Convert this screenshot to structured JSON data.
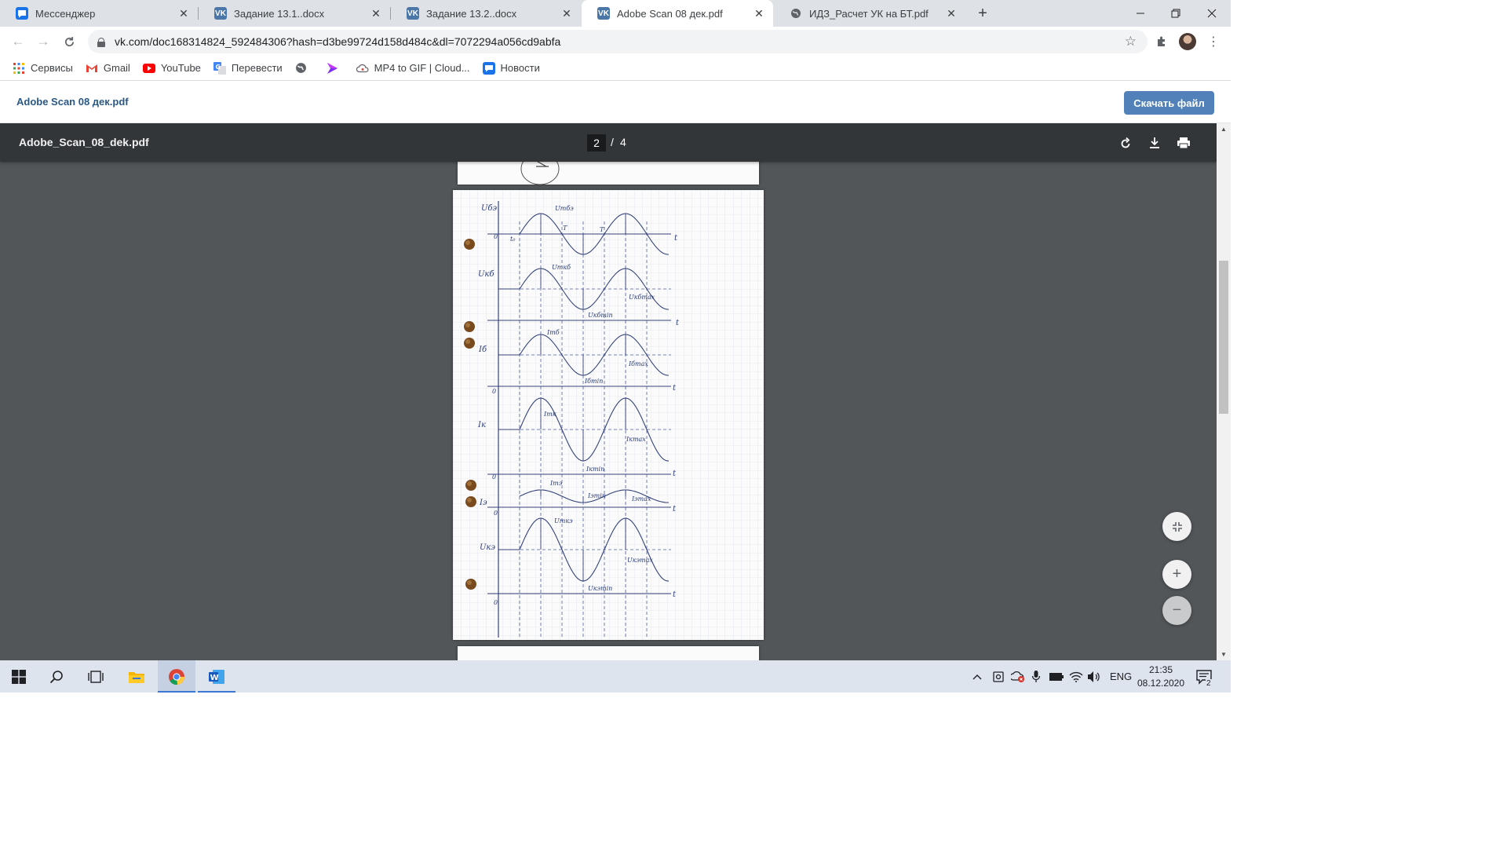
{
  "tabs": [
    {
      "title": "Мессенджер",
      "icon": "messenger-icon",
      "active": false
    },
    {
      "title": "Задание 13.1..docx",
      "icon": "vk-icon",
      "active": false
    },
    {
      "title": "Задание 13.2..docx",
      "icon": "vk-icon",
      "active": false
    },
    {
      "title": "Adobe Scan 08 дек.pdf",
      "icon": "vk-icon",
      "active": true
    },
    {
      "title": "ИДЗ_Расчет УК на БТ.pdf",
      "icon": "globe-icon",
      "active": false
    }
  ],
  "address": {
    "url": "vk.com/doc168314824_592484306?hash=d3be99724d158d484c&dl=7072294a056cd9abfa"
  },
  "bookmarks": [
    {
      "label": "Сервисы",
      "icon": "apps-grid-icon"
    },
    {
      "label": "Gmail",
      "icon": "gmail-icon"
    },
    {
      "label": "YouTube",
      "icon": "youtube-icon"
    },
    {
      "label": "Перевести",
      "icon": "translate-icon"
    },
    {
      "label": "",
      "icon": "globe-icon"
    },
    {
      "label": "",
      "icon": "arrow-logo-icon"
    },
    {
      "label": "MP4 to GIF | Cloud...",
      "icon": "cloud-icon"
    },
    {
      "label": "Новости",
      "icon": "news-icon"
    }
  ],
  "vk": {
    "doc_title": "Adobe Scan 08 дек.pdf",
    "download_label": "Скачать файл"
  },
  "pdf": {
    "file_name": "Adobe_Scan_08_dek.pdf",
    "current_page": "2",
    "separator": "/",
    "total_pages": "4"
  },
  "sketch_labels": {
    "ube": "Uбэ",
    "umbe": "Umбэ",
    "t0": "t₀",
    "T1": "T",
    "T2": "T",
    "zero1": "0",
    "t1": "t",
    "ukb": "Uкб",
    "umkb": "Umкб",
    "ukbmax": "Uкбmax",
    "ukbmin": "Uкбmin",
    "t2": "t",
    "ib": "Iб",
    "imb": "Imб",
    "ibmax": "Iбmax",
    "ibmin": "Iбmin",
    "zero3": "0",
    "t3": "t",
    "ik": "Iк",
    "imk": "Imк",
    "ikmax": "Iкmax",
    "ikmin": "Iкmin",
    "zero4": "0",
    "t4": "t",
    "ie": "Iэ",
    "ime": "Imэ",
    "iemin": "Iэmin",
    "iemax": "Iэmax",
    "zero5": "0",
    "t5": "t",
    "uke": "Uкэ",
    "umke": "Umкэ",
    "ukemax": "Uкэmax",
    "ukemin": "Uкэmin",
    "zero6": "0",
    "t6": "t"
  },
  "taskbar": {
    "apps": [
      "windows-start-icon",
      "search-icon",
      "task-view-icon",
      "file-explorer-icon",
      "chrome-icon",
      "word-icon"
    ],
    "lang": "ENG",
    "time": "21:35",
    "date": "08.12.2020",
    "notifications": "2"
  },
  "colors": {
    "vk_blue": "#5181b8",
    "pdf_toolbar": "#323639",
    "pdf_background": "#525659"
  }
}
